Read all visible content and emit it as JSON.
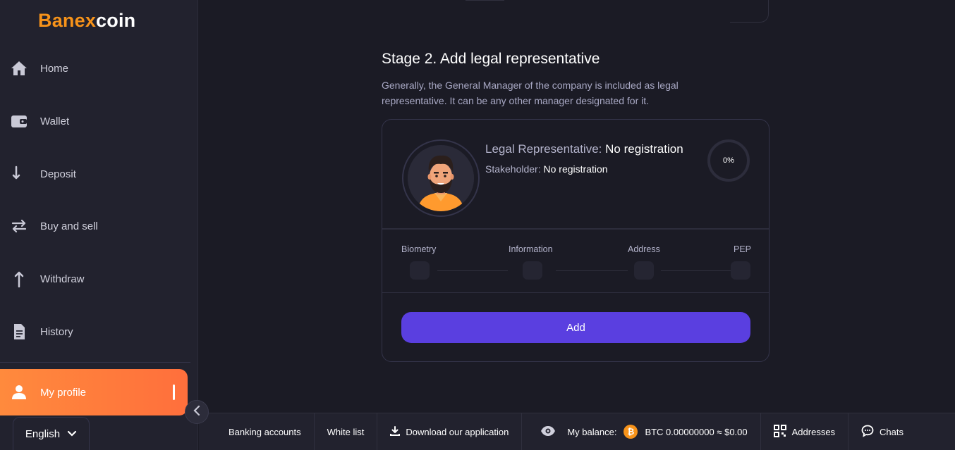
{
  "brand": {
    "part_a": "Banex",
    "part_b": "coin"
  },
  "sidebar": {
    "items": [
      {
        "label": "Home",
        "icon": "home-icon"
      },
      {
        "label": "Wallet",
        "icon": "wallet-icon"
      },
      {
        "label": "Deposit",
        "icon": "deposit-arrow-icon"
      },
      {
        "label": "Buy and sell",
        "icon": "swap-arrows-icon"
      },
      {
        "label": "Withdraw",
        "icon": "withdraw-arrow-icon"
      },
      {
        "label": "History",
        "icon": "document-icon"
      }
    ],
    "active": {
      "label": "My profile",
      "icon": "user-icon"
    },
    "language": "English"
  },
  "stage": {
    "title": "Stage 2. Add legal representative",
    "description": "Generally, the General Manager of the company is included as legal representative. It can be any other manager designated for it."
  },
  "representative": {
    "rep_label": "Legal Representative:",
    "rep_value": "No registration",
    "stake_label": "Stakeholder:",
    "stake_value": "No registration",
    "progress_text": "0%",
    "progress_value": 0
  },
  "steps": [
    {
      "label": "Biometry"
    },
    {
      "label": "Information"
    },
    {
      "label": "Address"
    },
    {
      "label": "PEP"
    }
  ],
  "add_button": "Add",
  "footer": {
    "banking": "Banking accounts",
    "whitelist": "White list",
    "download": "Download our application",
    "balance_label": "My balance:",
    "balance_value": "BTC 0.00000000 ≈ $0.00",
    "btc_symbol": "₿",
    "addresses": "Addresses",
    "chats": "Chats"
  },
  "colors": {
    "accent": "#5a3fe0",
    "brand_orange": "#f7931a",
    "active_gradient_start": "#ff8a3d",
    "background": "#1b1b25"
  }
}
